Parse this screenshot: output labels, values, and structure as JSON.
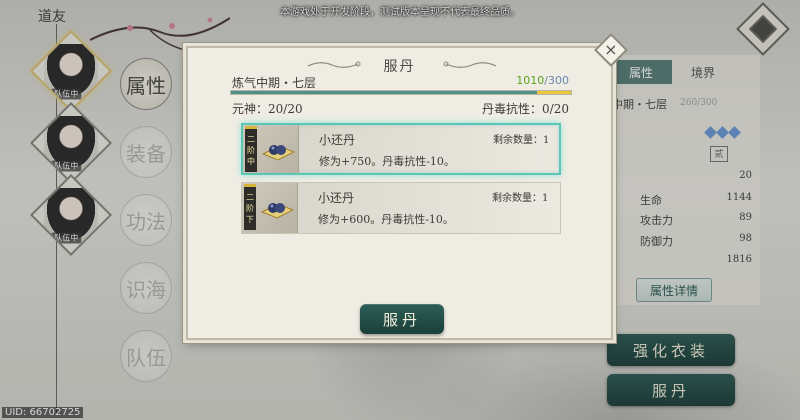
{
  "disclaimer": "本游戏处于开发阶段，测试版本呈现不代表最终品质。",
  "sidebar": {
    "title": "道友",
    "party": [
      {
        "tag": "队伍中",
        "active": true
      },
      {
        "tag": "队伍中",
        "active": false
      },
      {
        "tag": "队伍中",
        "active": false
      }
    ],
    "nav": [
      {
        "label": "属性",
        "active": true
      },
      {
        "label": "装备",
        "active": false
      },
      {
        "label": "功法",
        "active": false
      },
      {
        "label": "识海",
        "active": false
      },
      {
        "label": "队伍",
        "active": false
      }
    ]
  },
  "uid": "UID: 66702725",
  "right_panel": {
    "tabs": [
      "属性",
      "境界"
    ],
    "realm": "中期・七层",
    "xp": "260/300",
    "seal": "贰",
    "stats": [
      {
        "label": "",
        "value": "20"
      },
      {
        "label": "生命",
        "value": "1144"
      },
      {
        "label": "攻击力",
        "value": "89"
      },
      {
        "label": "防御力",
        "value": "98"
      },
      {
        "label": "",
        "value": "1816"
      }
    ],
    "attr_detail_label": "属性详情",
    "strengthen_label": "强化衣装",
    "take_pill_label": "服丹"
  },
  "dialog": {
    "title": "服丹",
    "realm": "炼气中期・七层",
    "xp_current": "1010",
    "xp_max": "300",
    "xp_progress": 1.0,
    "spirit": "元神：20/20",
    "resist": "丹毒抗性：0/20",
    "items": [
      {
        "grade": [
          "二",
          "阶",
          "中"
        ],
        "name": "小还丹",
        "effect": "修为+750。丹毒抗性-10。",
        "remain": "剩余数量：1",
        "selected": true
      },
      {
        "grade": [
          "二",
          "阶",
          "下"
        ],
        "name": "小还丹",
        "effect": "修为+600。丹毒抗性-10。",
        "remain": "剩余数量：1",
        "selected": false
      }
    ],
    "confirm_label": "服丹",
    "close_icon": "close-icon"
  },
  "colors": {
    "accent_teal": "#2e5e58",
    "selected_glow": "#5bc6b6",
    "xp_green": "#5aa320",
    "xp_blue": "#6a86b0",
    "bar_yellow": "#e9c839"
  }
}
